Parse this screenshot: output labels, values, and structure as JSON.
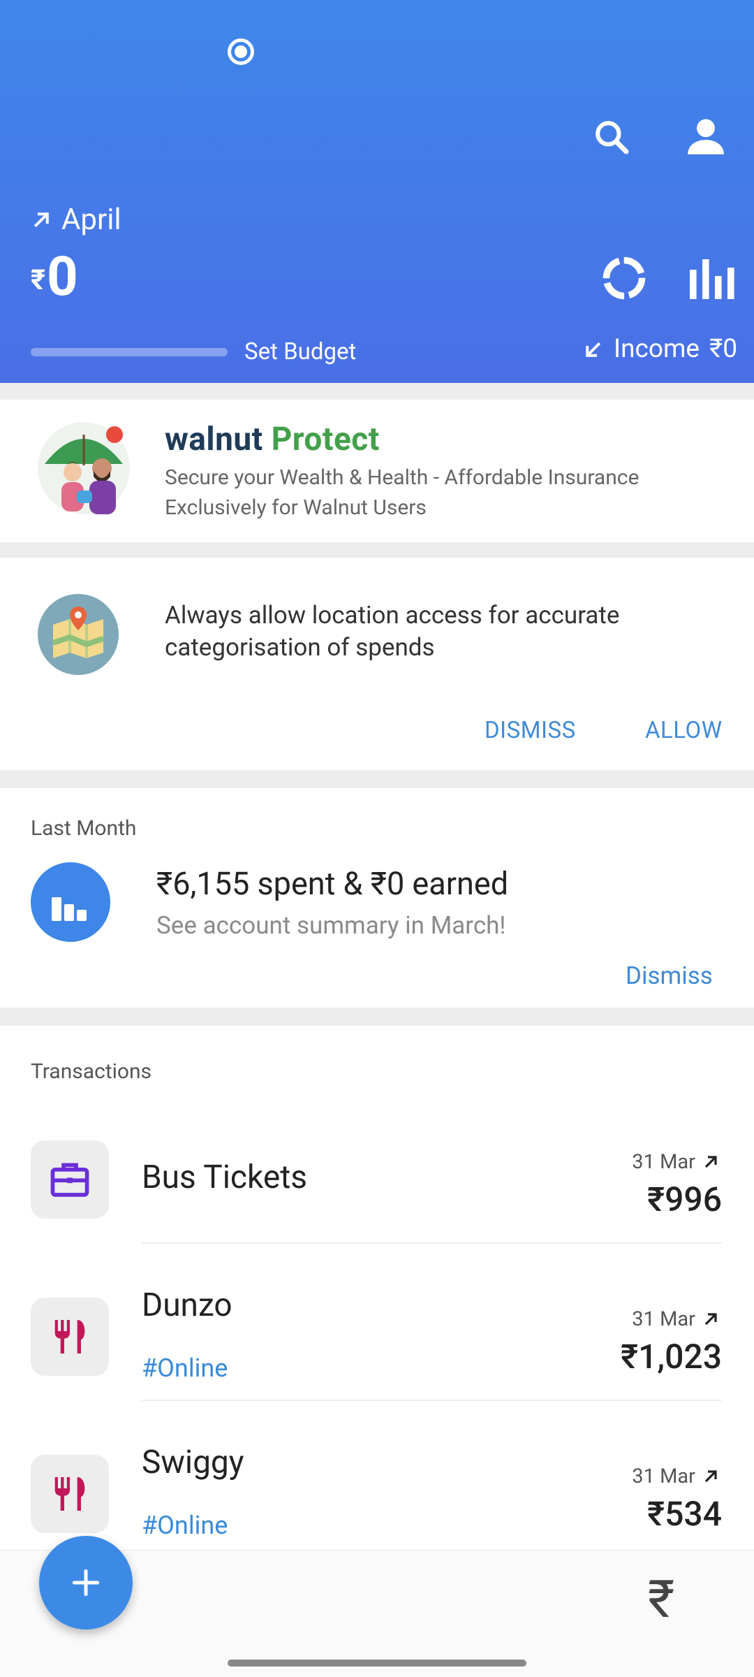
{
  "header": {
    "month": "April",
    "currency_symbol": "₹",
    "spent_amount": "0",
    "set_budget_label": "Set Budget",
    "income_label": "Income",
    "income_amount": "₹0"
  },
  "protect_card": {
    "brand_walnut": "walnut",
    "brand_protect": "Protect",
    "line1": "Secure your Wealth & Health - Affordable Insurance",
    "line2": "Exclusively for Walnut Users"
  },
  "location_card": {
    "line1": "Always allow location access for accurate",
    "line2": "categorisation of spends",
    "dismiss_label": "DISMISS",
    "allow_label": "ALLOW"
  },
  "last_month_card": {
    "label": "Last Month",
    "summary": "₹6,155 spent & ₹0 earned",
    "subtext": "See account summary in March!",
    "dismiss_label": "Dismiss"
  },
  "transactions": {
    "label": "Transactions",
    "items": [
      {
        "name": "Bus Tickets",
        "tag": "",
        "date": "31 Mar",
        "amount": "₹996",
        "icon": "briefcase-icon"
      },
      {
        "name": "Dunzo",
        "tag": "#Online",
        "date": "31 Mar",
        "amount": "₹1,023",
        "icon": "fork-knife-icon"
      },
      {
        "name": "Swiggy",
        "tag": "#Online",
        "date": "31 Mar",
        "amount": "₹534",
        "icon": "fork-knife-icon"
      }
    ]
  },
  "bottom_nav": {
    "fab_label": "+",
    "rupee_label": "₹"
  },
  "colors": {
    "header_top": "#3f87ea",
    "header_bottom": "#4a6fe6",
    "accent_blue": "#3f8bd8",
    "brand_green": "#43a04a",
    "food_red": "#c2185b",
    "bag_purple": "#6a2fd8"
  }
}
